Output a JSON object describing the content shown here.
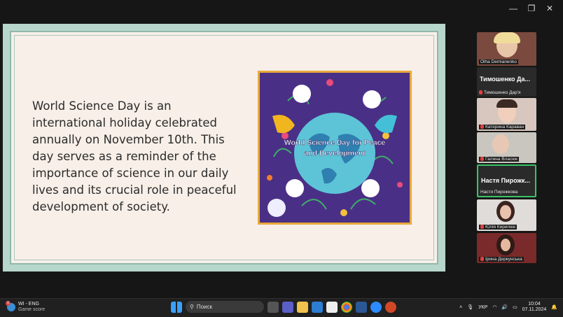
{
  "window": {
    "minimize": "—",
    "restore": "❐",
    "close": "✕"
  },
  "slide": {
    "text_lines": [
      "World Science Day is an",
      "international holiday celebrated",
      "annually on November 10th. This",
      "day serves as a reminder of the",
      "importance of science in our daily",
      "lives and its crucial role in peaceful",
      "development of society."
    ],
    "poster_title_1": "World Science Day for Peace",
    "poster_title_2": "and Development"
  },
  "participants": [
    {
      "name": "Olha Demianenko",
      "type": "video"
    },
    {
      "name": "Тимошенко Дар'я",
      "big": "Тимошенко Да...",
      "type": "name"
    },
    {
      "name": "Катерина Караван",
      "type": "video"
    },
    {
      "name": "Галина Власюк",
      "type": "video"
    },
    {
      "name": "Настя Пирожкова",
      "big": "Настя Пирожк...",
      "type": "name"
    },
    {
      "name": "Юлія Кирилюк",
      "type": "video"
    },
    {
      "name": "Ірина Деркунська",
      "type": "video"
    }
  ],
  "taskbar": {
    "weather_badge": "1",
    "weather_line1": "WI - ENG",
    "weather_line2": "Game score",
    "search_placeholder": "Поиск",
    "lang": "УКР",
    "time": "10:04",
    "date": "07.11.2024"
  }
}
